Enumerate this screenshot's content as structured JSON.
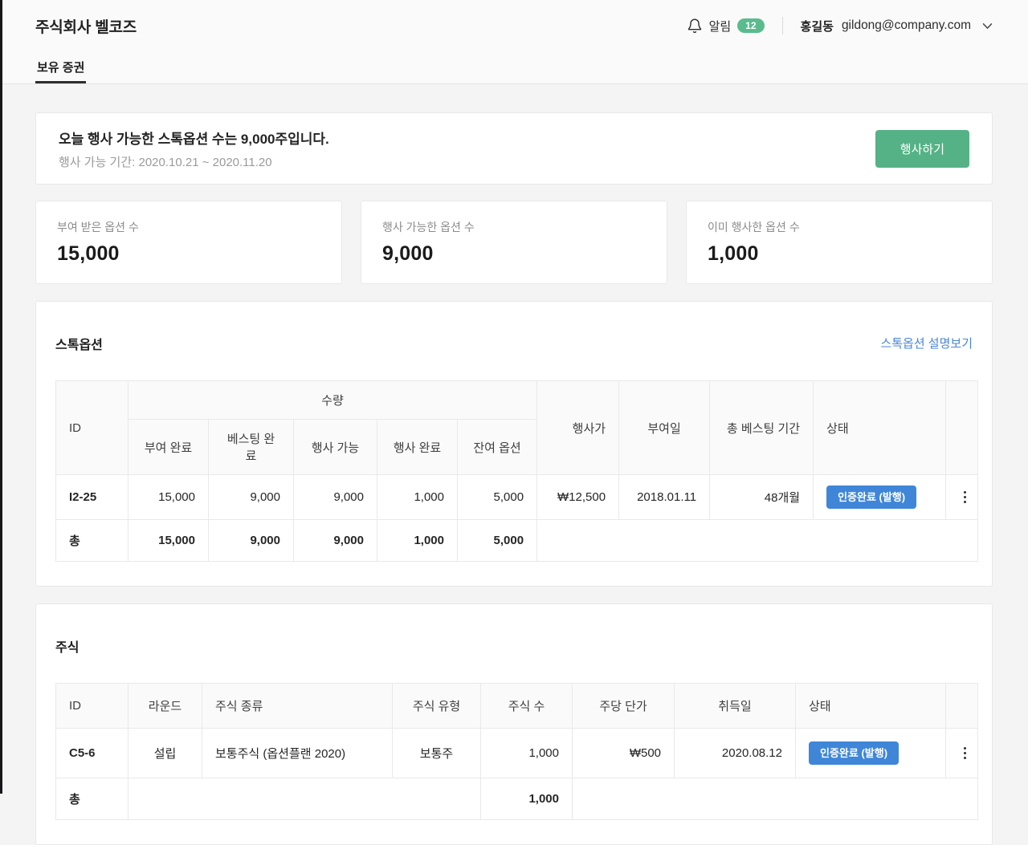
{
  "colors": {
    "accent_green": "#55b286",
    "notification_badge_green": "#5abb8e",
    "status_badge_blue": "#3f86d8",
    "link_blue": "#4a86d8"
  },
  "header": {
    "company_name": "주식회사 벨코즈",
    "notification_label": "알림",
    "notification_count": "12",
    "user_name": "홍길동",
    "user_email": "gildong@company.com"
  },
  "tabs": {
    "holdings": "보유 증권"
  },
  "banner": {
    "title": "오늘 행사 가능한 스톡옵션 수는 9,000주입니다.",
    "period": "행사 가능 기간: 2020.10.21 ~ 2020.11.20",
    "exercise_button": "행사하기"
  },
  "summary_cards": [
    {
      "label": "부여 받은 옵션 수",
      "value": "15,000"
    },
    {
      "label": "행사 가능한 옵션 수",
      "value": "9,000"
    },
    {
      "label": "이미 행사한 옵션 수",
      "value": "1,000"
    }
  ],
  "stock_options": {
    "title": "스톡옵션",
    "link": "스톡옵션 설명보기",
    "table": {
      "col_id": "ID",
      "col_qty_group": "수량",
      "col_granted": "부여 완료",
      "col_vested": "베스팅 완료",
      "col_exercisable": "행사 가능",
      "col_exercised": "행사 완료",
      "col_remaining": "잔여 옵션",
      "col_strike_price": "행사가",
      "col_grant_date": "부여일",
      "col_vesting_period": "총 베스팅 기간",
      "col_status": "상태",
      "row": {
        "id": "I2-25",
        "granted": "15,000",
        "vested": "9,000",
        "exercisable": "9,000",
        "exercised": "1,000",
        "remaining": "5,000",
        "strike_price": "₩12,500",
        "grant_date": "2018.01.11",
        "vesting_period": "48개월",
        "status": "인증완료 (발행)"
      },
      "total": {
        "label": "총",
        "granted": "15,000",
        "vested": "9,000",
        "exercisable": "9,000",
        "exercised": "1,000",
        "remaining": "5,000"
      }
    }
  },
  "shares": {
    "title": "주식",
    "table": {
      "col_id": "ID",
      "col_round": "라운드",
      "col_share_class": "주식 종류",
      "col_share_type": "주식 유형",
      "col_share_count": "주식 수",
      "col_unit_price": "주당 단가",
      "col_acquired_date": "취득일",
      "col_status": "상태",
      "row": {
        "id": "C5-6",
        "round": "설립",
        "share_class": "보통주식 (옵션플랜 2020)",
        "share_type": "보통주",
        "count": "1,000",
        "unit_price": "₩500",
        "acquired_date": "2020.08.12",
        "status": "인증완료 (발행)"
      },
      "total": {
        "label": "총",
        "count": "1,000"
      }
    }
  }
}
